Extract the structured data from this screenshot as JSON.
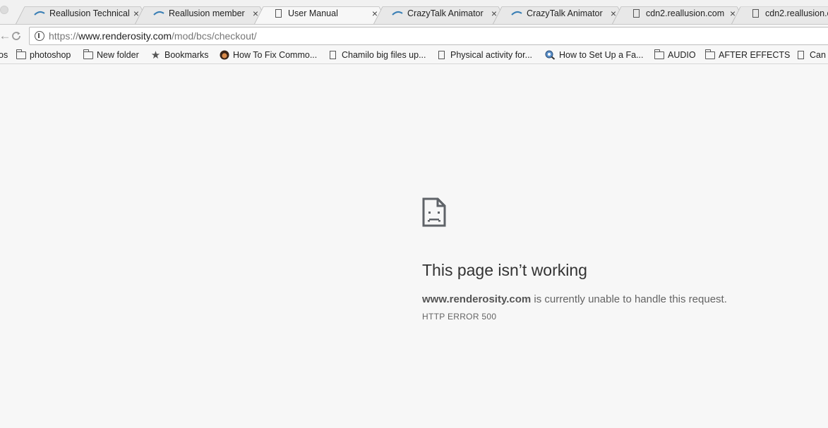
{
  "tabs": [
    {
      "title": "Reallusion Technical",
      "icon": "reallusion-icon",
      "close": "×"
    },
    {
      "title": "Reallusion member",
      "icon": "reallusion-icon",
      "close": "×"
    },
    {
      "title": "User Manual",
      "icon": "document-icon",
      "close": "×"
    },
    {
      "title": "CrazyTalk Animator",
      "icon": "reallusion-icon",
      "close": "×"
    },
    {
      "title": "CrazyTalk Animator",
      "icon": "reallusion-icon",
      "close": "×"
    },
    {
      "title": "cdn2.reallusion.com",
      "icon": "document-icon",
      "close": "×"
    },
    {
      "title": "cdn2.reallusion.c",
      "icon": "document-icon",
      "close": ""
    }
  ],
  "toolbar": {
    "back_glyph": "←",
    "reload_glyph": "C"
  },
  "omnibox": {
    "scheme": "https://",
    "host": "www.renderosity.com",
    "path": "/mod/bcs/checkout/"
  },
  "bookmarks": [
    {
      "label": "os",
      "icon": "none"
    },
    {
      "label": "photoshop",
      "icon": "folder-icon"
    },
    {
      "label": "New folder",
      "icon": "folder-icon"
    },
    {
      "label": "Bookmarks",
      "icon": "star-icon"
    },
    {
      "label": "How To Fix Commo...",
      "icon": "avatar-icon"
    },
    {
      "label": "Chamilo big files up...",
      "icon": "document-icon"
    },
    {
      "label": "Physical activity for...",
      "icon": "document-icon"
    },
    {
      "label": "How to Set Up a Fa...",
      "icon": "search-globe-icon"
    },
    {
      "label": "AUDIO",
      "icon": "folder-icon"
    },
    {
      "label": "AFTER EFFECTS",
      "icon": "folder-icon"
    },
    {
      "label": "Can",
      "icon": "document-icon"
    }
  ],
  "error": {
    "title": "This page isn’t working",
    "host": "www.renderosity.com",
    "message": " is currently unable to handle this request.",
    "code": "HTTP ERROR 500"
  }
}
